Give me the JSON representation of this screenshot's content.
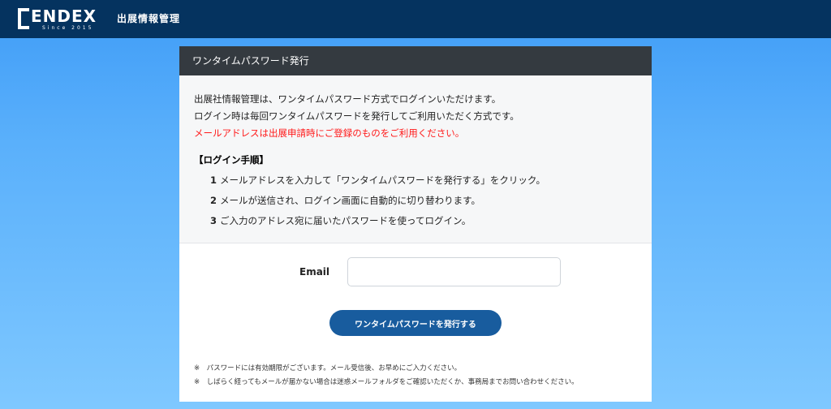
{
  "header": {
    "logo_word": "ENDEX",
    "logo_since": "Since 2015",
    "title": "出展情報管理"
  },
  "card": {
    "title": "ワンタイムパスワード発行",
    "intro": [
      "出展社情報管理は、ワンタイムパスワード方式でログインいただけます。",
      "ログイン時は毎回ワンタイムパスワードを発行してご利用いただく方式です。"
    ],
    "warning": "メールアドレスは出展申請時にご登録のものをご利用ください。",
    "steps_title": "【ログイン手順】",
    "steps": [
      {
        "num": "1",
        "text": "メールアドレスを入力して「ワンタイムパスワードを発行する」をクリック。"
      },
      {
        "num": "2",
        "text": "メールが送信され、ログイン画面に自動的に切り替わります。"
      },
      {
        "num": "3",
        "text": "ご入力のアドレス宛に届いたパスワードを使ってログイン。"
      }
    ],
    "email_label": "Email",
    "email_value": "",
    "email_placeholder": "",
    "submit_label": "ワンタイムパスワードを発行する",
    "notes": [
      "※　パスワードには有効期限がございます。メール受信後、お早めにご入力ください。",
      "※　しばらく経ってもメールが届かない場合は迷惑メールフォルダをご確認いただくか、事務局までお問い合わせください。"
    ]
  },
  "colors": {
    "topbar": "#05335f",
    "card_header": "#343a40",
    "button": "#185c9e",
    "warning_text": "#ff1a1a"
  }
}
